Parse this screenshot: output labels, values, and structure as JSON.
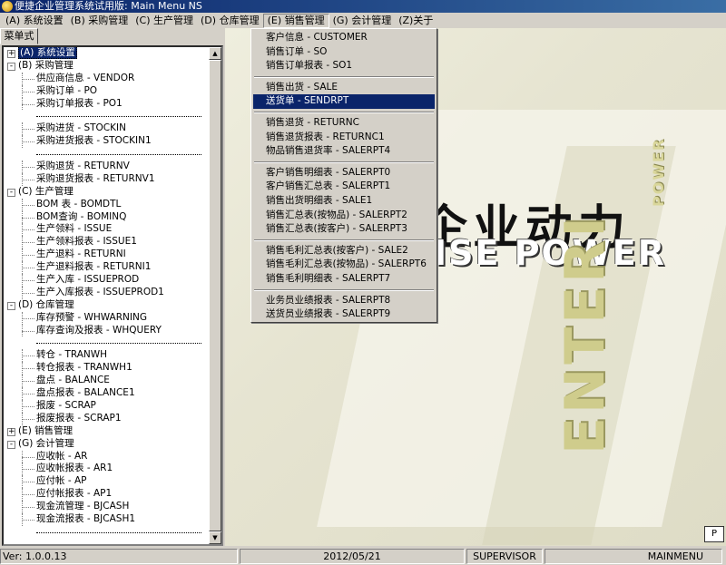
{
  "window": {
    "title": "便捷企业管理系统试用版: Main Menu NS"
  },
  "menubar": [
    {
      "label": "(A) 系统设置",
      "active": false
    },
    {
      "label": "(B) 采购管理",
      "active": false
    },
    {
      "label": "(C) 生产管理",
      "active": false
    },
    {
      "label": "(D) 仓库管理",
      "active": false
    },
    {
      "label": "(E) 销售管理",
      "active": true
    },
    {
      "label": "(G) 会计管理",
      "active": false
    },
    {
      "label": "(Z)关于",
      "active": false
    }
  ],
  "tab": {
    "label": "菜单式"
  },
  "tree": [
    {
      "type": "top",
      "expander": "+",
      "label": "(A) 系统设置",
      "selected": true
    },
    {
      "type": "top",
      "expander": "-",
      "label": "(B) 采购管理"
    },
    {
      "type": "child",
      "label": "供应商信息 - VENDOR"
    },
    {
      "type": "child",
      "label": "采购订单 - PO"
    },
    {
      "type": "child",
      "label": "采购订单报表 - PO1"
    },
    {
      "type": "sep"
    },
    {
      "type": "child",
      "label": "采购进货 - STOCKIN"
    },
    {
      "type": "child",
      "label": "采购进货报表 - STOCKIN1"
    },
    {
      "type": "sep"
    },
    {
      "type": "child",
      "label": "采购退货 - RETURNV"
    },
    {
      "type": "child",
      "label": "采购退货报表 - RETURNV1"
    },
    {
      "type": "top",
      "expander": "-",
      "label": "(C) 生产管理"
    },
    {
      "type": "child",
      "label": "BOM 表 - BOMDTL"
    },
    {
      "type": "child",
      "label": "BOM查询 - BOMINQ"
    },
    {
      "type": "child",
      "label": "生产领料 - ISSUE"
    },
    {
      "type": "child",
      "label": "生产领料报表 - ISSUE1"
    },
    {
      "type": "child",
      "label": "生产退料 - RETURNI"
    },
    {
      "type": "child",
      "label": "生产退料报表 - RETURNI1"
    },
    {
      "type": "child",
      "label": "生产入库 - ISSUEPROD"
    },
    {
      "type": "child",
      "label": "生产入库报表 - ISSUEPROD1"
    },
    {
      "type": "top",
      "expander": "-",
      "label": "(D) 仓库管理"
    },
    {
      "type": "child",
      "label": "库存预警 - WHWARNING"
    },
    {
      "type": "child",
      "label": "库存查询及报表 - WHQUERY"
    },
    {
      "type": "sep"
    },
    {
      "type": "child",
      "label": "转仓 - TRANWH"
    },
    {
      "type": "child",
      "label": "转仓报表 - TRANWH1"
    },
    {
      "type": "child",
      "label": "盘点 - BALANCE"
    },
    {
      "type": "child",
      "label": "盘点报表 - BALANCE1"
    },
    {
      "type": "child",
      "label": "报废 - SCRAP"
    },
    {
      "type": "child",
      "label": "报废报表 - SCRAP1"
    },
    {
      "type": "top",
      "expander": "+",
      "label": "(E) 销售管理"
    },
    {
      "type": "top",
      "expander": "-",
      "label": "(G) 会计管理"
    },
    {
      "type": "child",
      "label": "应收帐 - AR"
    },
    {
      "type": "child",
      "label": "应收帐报表 - AR1"
    },
    {
      "type": "child",
      "label": "应付帐 - AP"
    },
    {
      "type": "child",
      "label": "应付帐报表 - AP1"
    },
    {
      "type": "child",
      "label": "现金流管理 - BJCASH"
    },
    {
      "type": "child",
      "label": "现金流报表 - BJCASH1"
    },
    {
      "type": "sep"
    }
  ],
  "dropdown": [
    {
      "type": "item",
      "label": "客户信息 - CUSTOMER"
    },
    {
      "type": "item",
      "label": "销售订单 - SO"
    },
    {
      "type": "item",
      "label": "销售订单报表 - SO1"
    },
    {
      "type": "sep"
    },
    {
      "type": "item",
      "label": "销售出货 - SALE"
    },
    {
      "type": "item",
      "label": "送货单 - SENDRPT",
      "highlight": true
    },
    {
      "type": "sep"
    },
    {
      "type": "item",
      "label": "销售退货 - RETURNC"
    },
    {
      "type": "item",
      "label": "销售退货报表 - RETURNC1"
    },
    {
      "type": "item",
      "label": "物品销售退货率 - SALERPT4"
    },
    {
      "type": "sep"
    },
    {
      "type": "item",
      "label": "客户销售明细表 - SALERPT0"
    },
    {
      "type": "item",
      "label": "客户销售汇总表 - SALERPT1"
    },
    {
      "type": "item",
      "label": "销售出货明细表 - SALE1"
    },
    {
      "type": "item",
      "label": "销售汇总表(按物品) - SALERPT2"
    },
    {
      "type": "item",
      "label": "销售汇总表(按客户) - SALERPT3"
    },
    {
      "type": "sep"
    },
    {
      "type": "item",
      "label": "销售毛利汇总表(按客户) - SALE2"
    },
    {
      "type": "item",
      "label": "销售毛利汇总表(按物品) - SALERPT6"
    },
    {
      "type": "item",
      "label": "销售毛利明细表 - SALERPT7"
    },
    {
      "type": "sep"
    },
    {
      "type": "item",
      "label": "业务员业绩报表 - SALERPT8"
    },
    {
      "type": "item",
      "label": "送货员业绩报表 - SALERPT9"
    }
  ],
  "logo": {
    "cn": "企业动力",
    "en": "ISE POWER",
    "vertical": "ENTERI",
    "vertical_small": "POWER"
  },
  "statusbar": {
    "version": "Ver: 1.0.0.13",
    "date": "2012/05/21",
    "user": "SUPERVISOR",
    "screen": "MAINMENU"
  },
  "colors": {
    "highlight": "#0a246a",
    "face": "#d4d0c8",
    "title_start": "#0a246a",
    "title_end": "#3a6ea5"
  }
}
